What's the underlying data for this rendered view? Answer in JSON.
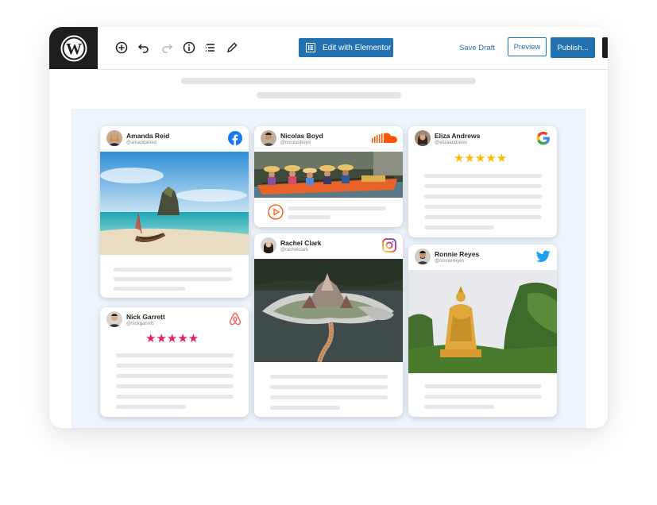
{
  "toolbar": {
    "add_icon": "plus-circle-icon",
    "undo_icon": "undo-icon",
    "redo_icon": "redo-icon",
    "info_icon": "info-icon",
    "list_icon": "list-view-icon",
    "edit_icon": "pencil-icon",
    "elementor_label": "Edit with Elementor",
    "save_draft": "Save Draft",
    "preview": "Preview",
    "publish": "Publish...",
    "accent": "#2271b1"
  },
  "cards": [
    {
      "name": "Amanda Reid",
      "handle": "@amandareid",
      "platform": "facebook",
      "brand_color": "#1877f2"
    },
    {
      "name": "Nick Garrett",
      "handle": "@nickgarrett",
      "platform": "airbnb",
      "brand_color": "#ff5a5f",
      "stars": "★★★★★",
      "star_color": "#e8215c"
    },
    {
      "name": "Nicolas Boyd",
      "handle": "@nicolasboyd",
      "platform": "soundcloud",
      "brand_color": "#ff5500"
    },
    {
      "name": "Rachel Clark",
      "handle": "@rachelclark",
      "platform": "instagram",
      "brand_color": "#c13584"
    },
    {
      "name": "Eliza Andrews",
      "handle": "@elizaandrews",
      "platform": "google",
      "brand_color": "#4285f4",
      "stars": "★★★★★",
      "star_color": "#fbbc05"
    },
    {
      "name": "Ronnie Reyes",
      "handle": "@ronniereyes",
      "platform": "twitter",
      "brand_color": "#1da1f2"
    }
  ]
}
